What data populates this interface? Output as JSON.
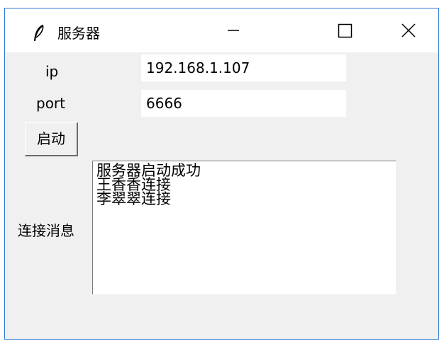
{
  "window": {
    "title": "服务器",
    "icon": "feather-icon",
    "controls": [
      "minimize-icon",
      "maximize-icon",
      "close-icon"
    ]
  },
  "form": {
    "ip_label": "ip",
    "ip_value": "192.168.1.107",
    "port_label": "port",
    "port_value": "6666",
    "start_label": "启动",
    "messages_label": "连接消息"
  },
  "log": {
    "lines": [
      "服务器启动成功",
      "王香香连接",
      "李翠翠连接"
    ]
  },
  "colors": {
    "frame_border": "#2b78d6",
    "background": "#f0f0f0",
    "field_bg": "#ffffff"
  }
}
